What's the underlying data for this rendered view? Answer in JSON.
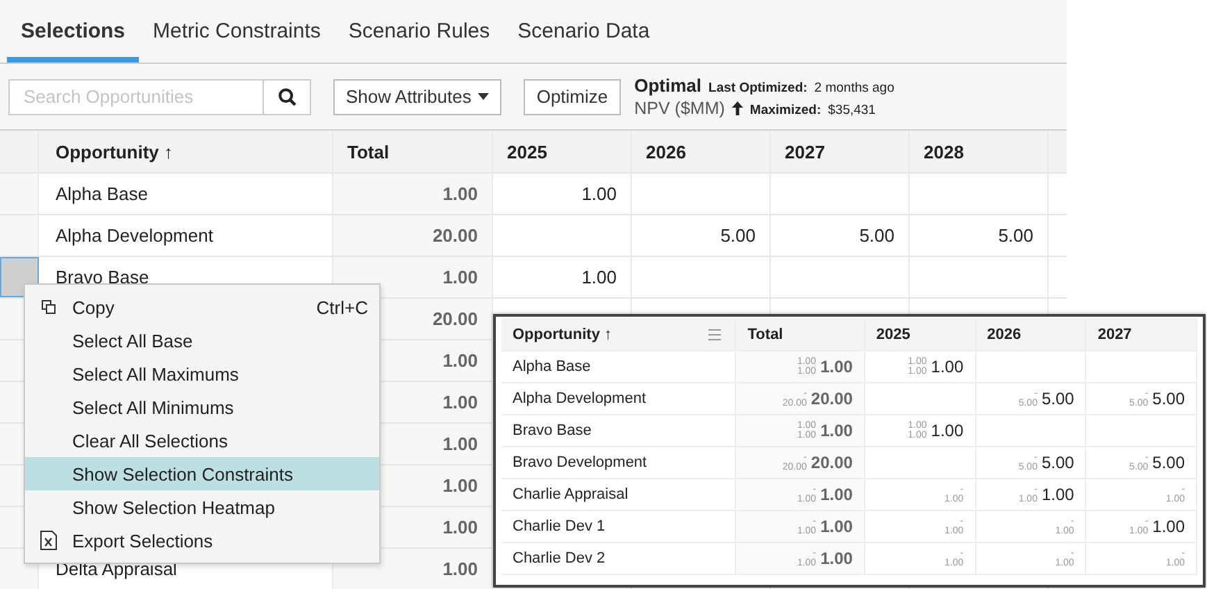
{
  "tabs": [
    {
      "label": "Selections",
      "selected": true
    },
    {
      "label": "Metric Constraints",
      "selected": false
    },
    {
      "label": "Scenario Rules",
      "selected": false
    },
    {
      "label": "Scenario Data",
      "selected": false
    }
  ],
  "toolbar": {
    "search": {
      "placeholder": "Search Opportunities"
    },
    "attributes_button": "Show Attributes",
    "optimize_button": "Optimize",
    "status": {
      "state": "Optimal",
      "last_optimized_label": "Last Optimized:",
      "last_optimized": "2 months ago",
      "metric": "NPV ($MM)",
      "objective_label": "Maximized:",
      "objective_value": "$35,431"
    }
  },
  "table": {
    "columns": [
      "Opportunity ↑",
      "Total",
      "2025",
      "2026",
      "2027",
      "2028"
    ],
    "rows": [
      {
        "opportunity": "Alpha Base",
        "total": "1.00",
        "year_1": "1.00",
        "selected": false
      },
      {
        "opportunity": "Alpha Development",
        "total": "20.00",
        "year_2": "5.00",
        "year_3": "5.00",
        "year_4": "5.00",
        "selected": false
      },
      {
        "opportunity": "Bravo Base",
        "total": "1.00",
        "year_1": "1.00",
        "selected": true
      },
      {
        "total": "20.00",
        "selected": false
      },
      {
        "total": "1.00",
        "selected": false
      },
      {
        "total": "1.00",
        "selected": false
      },
      {
        "total": "1.00",
        "selected": false
      },
      {
        "total": "1.00",
        "selected": false
      },
      {
        "total": "1.00",
        "selected": false
      },
      {
        "opportunity": "Delta Appraisal",
        "total": "1.00",
        "selected": false
      }
    ]
  },
  "context_menu": [
    {
      "label": "Copy",
      "shortcut": "Ctrl+C",
      "kind": "copy",
      "selected": false
    },
    {
      "label": "Select All Base",
      "kind": "plain",
      "selected": false
    },
    {
      "label": "Select All Maximums",
      "kind": "plain",
      "selected": false
    },
    {
      "label": "Select All Minimums",
      "kind": "plain",
      "selected": false
    },
    {
      "label": "Clear All Selections",
      "kind": "plain",
      "selected": false
    },
    {
      "label": "Show Selection Constraints",
      "kind": "plain",
      "selected": true
    },
    {
      "label": "Show Selection Heatmap",
      "kind": "plain",
      "selected": false
    },
    {
      "label": "Export Selections",
      "kind": "export",
      "selected": false
    }
  ],
  "inset_table": {
    "columns": [
      "Opportunity ↑",
      "Total",
      "2025",
      "2026",
      "2027"
    ],
    "rows": [
      {
        "opportunity": "Alpha Base",
        "cells": [
          {
            "upper": "1.00",
            "lower": "1.00",
            "value": "1.00"
          },
          {
            "upper": "1.00",
            "lower": "1.00",
            "value": "1.00"
          },
          {},
          {}
        ]
      },
      {
        "opportunity": "Alpha Development",
        "cells": [
          {
            "upper": "-",
            "lower": "20.00",
            "value": "20.00"
          },
          {},
          {
            "upper": "-",
            "lower": "5.00",
            "value": "5.00"
          },
          {
            "upper": "-",
            "lower": "5.00",
            "value": "5.00"
          }
        ]
      },
      {
        "opportunity": "Bravo Base",
        "cells": [
          {
            "upper": "1.00",
            "lower": "1.00",
            "value": "1.00"
          },
          {
            "upper": "1.00",
            "lower": "1.00",
            "value": "1.00"
          },
          {},
          {}
        ]
      },
      {
        "opportunity": "Bravo Development",
        "cells": [
          {
            "upper": "-",
            "lower": "20.00",
            "value": "20.00"
          },
          {},
          {
            "upper": "-",
            "lower": "5.00",
            "value": "5.00"
          },
          {
            "upper": "-",
            "lower": "5.00",
            "value": "5.00"
          }
        ]
      },
      {
        "opportunity": "Charlie Appraisal",
        "cells": [
          {
            "upper": "-",
            "lower": "1.00",
            "value": "1.00"
          },
          {
            "upper": "-",
            "lower": "1.00"
          },
          {
            "upper": "-",
            "lower": "1.00",
            "value": "1.00"
          },
          {
            "upper": "-",
            "lower": "1.00"
          }
        ]
      },
      {
        "opportunity": "Charlie Dev 1",
        "cells": [
          {
            "upper": "-",
            "lower": "1.00",
            "value": "1.00"
          },
          {
            "upper": "-",
            "lower": "1.00"
          },
          {
            "upper": "-",
            "lower": "1.00"
          },
          {
            "upper": "-",
            "lower": "1.00",
            "value": "1.00"
          }
        ]
      },
      {
        "opportunity": "Charlie Dev 2",
        "cells": [
          {
            "upper": "-",
            "lower": "1.00",
            "value": "1.00"
          },
          {
            "upper": "-",
            "lower": "1.00"
          },
          {
            "upper": "-",
            "lower": "1.00"
          },
          {
            "upper": "-",
            "lower": "1.00"
          }
        ]
      }
    ]
  }
}
